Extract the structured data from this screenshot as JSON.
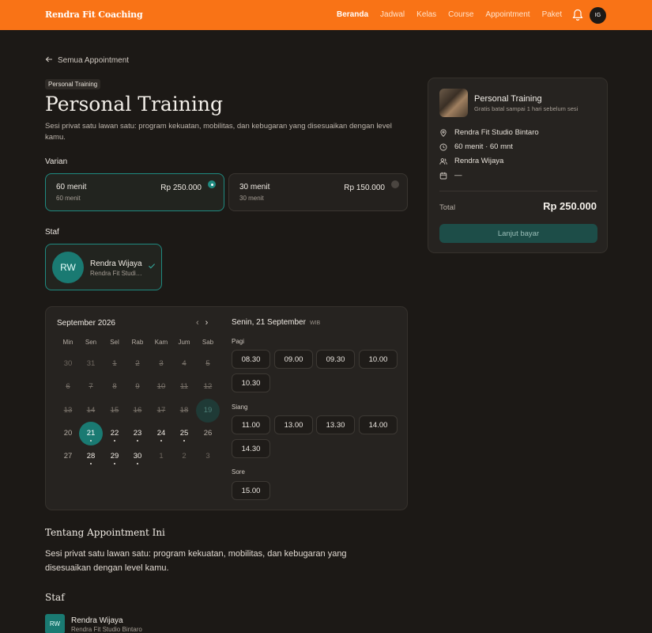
{
  "header": {
    "brand": "Rendra Fit Coaching",
    "nav": [
      "Beranda",
      "Jadwal",
      "Kelas",
      "Course",
      "Appointment",
      "Paket"
    ],
    "active_nav": "Beranda",
    "user_initials": "IG",
    "accent_color": "#f97316"
  },
  "page": {
    "back_label": "Semua Appointment",
    "tag": "Personal Training",
    "title": "Personal Training",
    "description": "Sesi privat satu lawan satu: program kekuatan, mobilitas, dan kebugaran yang disesuaikan dengan level kamu.",
    "variant_label": "Varian",
    "variants": [
      {
        "name": "60 menit",
        "sub": "60 menit",
        "price": "Rp 250.000",
        "selected": true
      },
      {
        "name": "30 menit",
        "sub": "30 menit",
        "price": "Rp 150.000",
        "selected": false
      }
    ],
    "staff_label": "Staf",
    "staff": {
      "initials": "RW",
      "name": "Rendra Wijaya",
      "location": "Rendra Fit Studi…"
    }
  },
  "calendar": {
    "month": "September 2026",
    "weekdays": [
      "Min",
      "Sen",
      "Sel",
      "Rab",
      "Kam",
      "Jum",
      "Sab"
    ],
    "weeks": [
      [
        "30",
        "31",
        "1",
        "2",
        "3",
        "4",
        "5"
      ],
      [
        "6",
        "7",
        "8",
        "9",
        "10",
        "11",
        "12"
      ],
      [
        "13",
        "14",
        "15",
        "16",
        "17",
        "18",
        "19"
      ],
      [
        "20",
        "21",
        "22",
        "23",
        "24",
        "25",
        "26"
      ],
      [
        "27",
        "28",
        "29",
        "30",
        "1",
        "2",
        "3"
      ]
    ],
    "selected_day": "21",
    "day_title": "Senin, 21 September",
    "timezone": "WIB",
    "periods": [
      {
        "label": "Pagi",
        "slots": [
          "08.30",
          "09.00",
          "09.30",
          "10.00",
          "10.30"
        ]
      },
      {
        "label": "Siang",
        "slots": [
          "11.00",
          "13.00",
          "13.30",
          "14.00",
          "14.30"
        ]
      },
      {
        "label": "Sore",
        "slots": [
          "15.00"
        ]
      }
    ]
  },
  "about": {
    "title": "Tentang Appointment Ini",
    "text": "Sesi privat satu lawan satu: program kekuatan, mobilitas, dan kebugaran yang disesuaikan dengan level kamu.",
    "staff_title": "Staf",
    "staff_initials": "RW",
    "staff_name": "Rendra Wijaya",
    "staff_location": "Rendra Fit Studio Bintaro"
  },
  "summary": {
    "title": "Personal Training",
    "subtitle": "Gratis batal sampai 1 hari sebelum sesi",
    "location": "Rendra Fit Studio Bintaro",
    "duration": "60 menit · 60 mnt",
    "staff": "Rendra Wijaya",
    "date": "—",
    "total_label": "Total",
    "total_value": "Rp 250.000",
    "pay_label": "Lanjut bayar"
  }
}
